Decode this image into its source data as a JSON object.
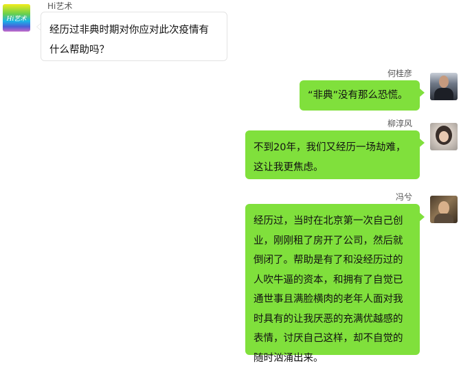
{
  "messages": [
    {
      "sender": "Hi艺术",
      "avatar_text": "Hi艺术",
      "text": "经历过非典时期对你应对此次疫情有什么帮助吗？",
      "side": "left"
    },
    {
      "sender": "何桂彦",
      "text": "“非典”没有那么恐慌。",
      "side": "right"
    },
    {
      "sender": "柳淳风",
      "text": "不到20年，我们又经历一场劫难，这让我更焦虑。",
      "side": "right"
    },
    {
      "sender": "冯兮",
      "text": "经历过，当时在北京第一次自己创业，刚刚租了房开了公司，然后就倒闭了。帮助是有了和没经历过的人吹牛逼的资本，和拥有了自觉已通世事且满脸横肉的老年人面对我时具有的让我厌恶的充满优越感的表情，讨厌自己这样，却不自觉的随时汹涌出来。",
      "side": "right"
    }
  ],
  "colors": {
    "outgoing_bubble": "#80e03c",
    "incoming_bubble": "#ffffff",
    "sender_name": "#555555"
  }
}
